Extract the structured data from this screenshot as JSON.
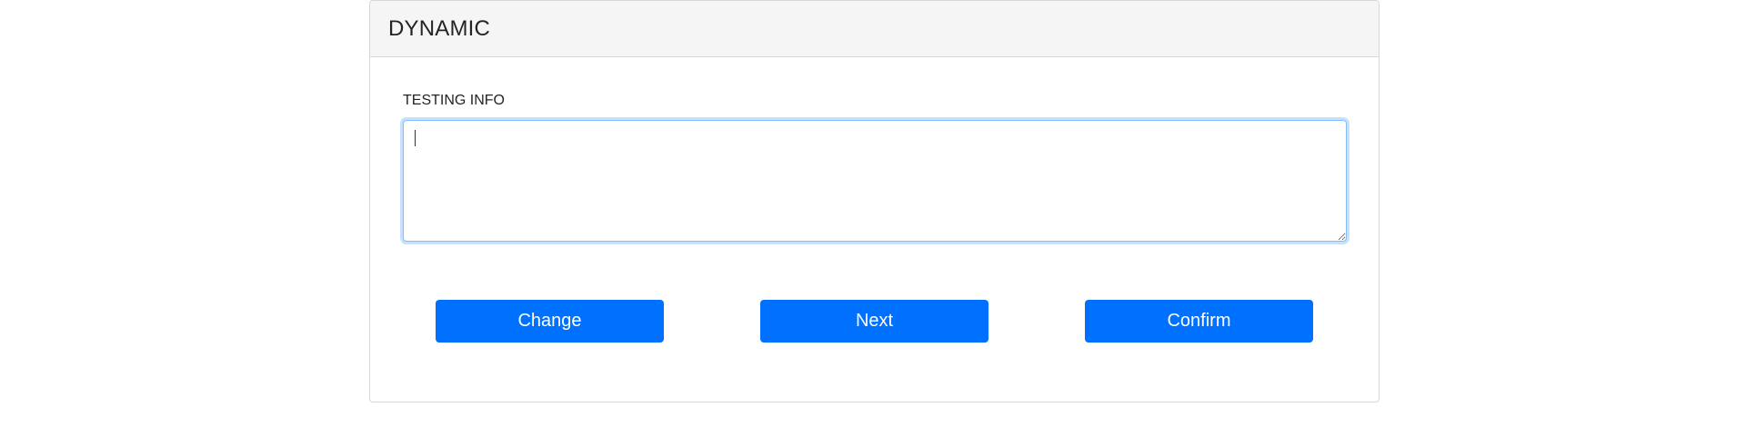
{
  "card": {
    "title": "DYNAMIC"
  },
  "form": {
    "label": "TESTING INFO",
    "textarea_value": "",
    "textarea_placeholder": ""
  },
  "buttons": {
    "change_label": "Change",
    "next_label": "Next",
    "confirm_label": "Confirm"
  },
  "colors": {
    "primary": "#0070ff",
    "header_bg": "#f5f5f5",
    "focus_border": "#80bdff"
  }
}
